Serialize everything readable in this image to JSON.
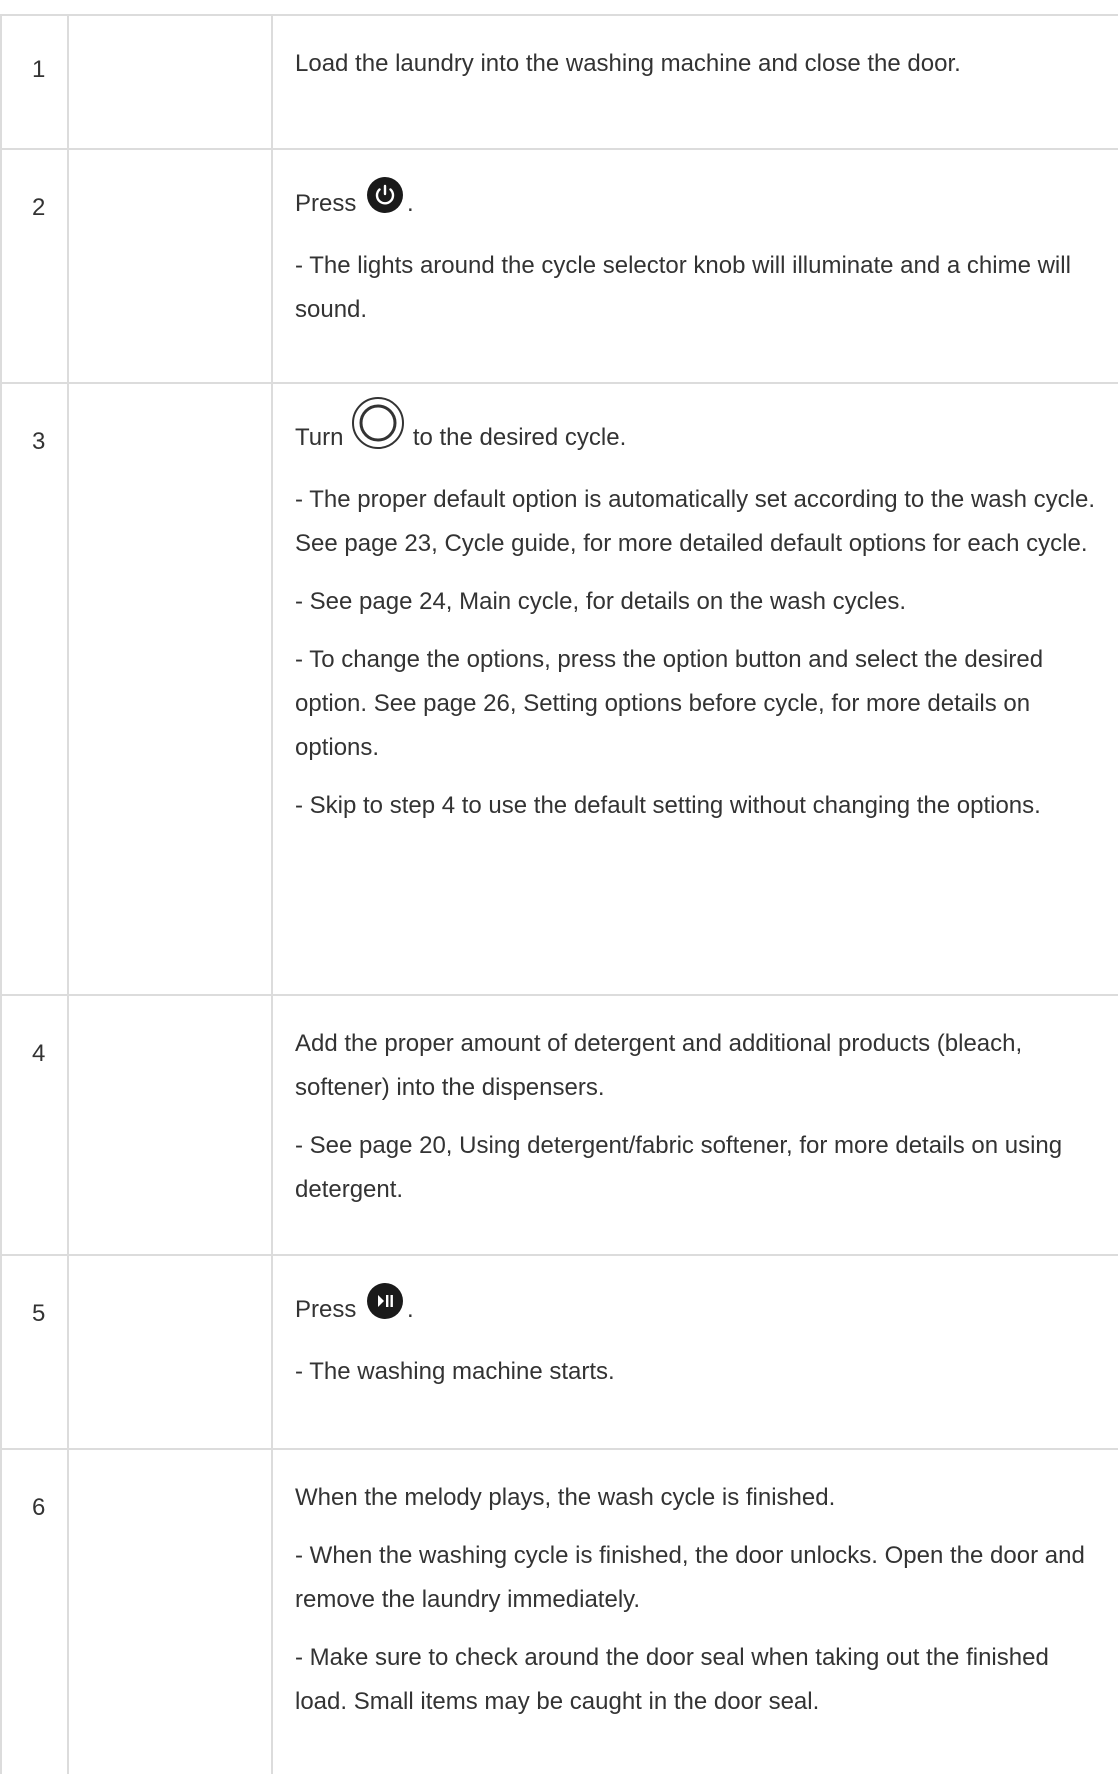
{
  "steps": [
    {
      "num": "1",
      "lines": [
        "Load the laundry into the washing machine and close the door."
      ]
    },
    {
      "num": "2",
      "lead_before": "Press",
      "lead_after": ".",
      "icon": "power-icon",
      "lines": [
        "- The lights around the cycle selector knob will illuminate and a chime will sound."
      ]
    },
    {
      "num": "3",
      "lead_before": "Turn",
      "lead_after": "to the desired cycle.",
      "icon": "cycle-selector-knob-icon",
      "lines": [
        "- The proper default option is automatically set according to the wash cycle. See page 23, Cycle guide, for more detailed default options for each cycle.",
        "- See page 24, Main cycle, for details on the wash cycles.",
        "- To change the options, press the option button and select the desired option. See page 26, Setting options before cycle, for more details on options.",
        "- Skip to step 4 to use the default setting without changing the options."
      ]
    },
    {
      "num": "4",
      "lines": [
        "Add the proper amount of detergent and additional products (bleach, softener) into the dispensers.",
        "- See page 20, Using detergent/fabric softener, for more details on using detergent."
      ]
    },
    {
      "num": "5",
      "lead_before": "Press",
      "lead_after": ".",
      "icon": "start-pause-icon",
      "lines": [
        "- The washing machine starts."
      ]
    },
    {
      "num": "6",
      "lines": [
        "When the melody plays, the wash cycle is finished.",
        "- When the washing cycle is finished, the door unlocks. Open the door and remove the laundry immediately.",
        "- Make sure to check around the door seal when taking out the finished load. Small items may be caught in the door seal."
      ]
    }
  ]
}
